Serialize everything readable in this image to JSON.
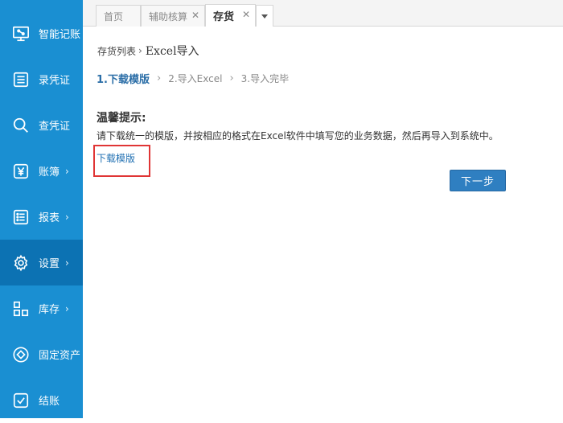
{
  "sidebar": {
    "items": [
      {
        "label": "智能记账",
        "icon": "monitor-icon",
        "has_arrow": false
      },
      {
        "label": "录凭证",
        "icon": "voucher-entry-icon",
        "has_arrow": false
      },
      {
        "label": "查凭证",
        "icon": "search-icon",
        "has_arrow": false
      },
      {
        "label": "账簿",
        "icon": "yen-icon",
        "has_arrow": true
      },
      {
        "label": "报表",
        "icon": "report-list-icon",
        "has_arrow": true
      },
      {
        "label": "设置",
        "icon": "gear-icon",
        "has_arrow": true,
        "active": true
      },
      {
        "label": "库存",
        "icon": "inventory-grid-icon",
        "has_arrow": true
      },
      {
        "label": "固定资产",
        "icon": "asset-diamond-icon",
        "has_arrow": false
      },
      {
        "label": "结账",
        "icon": "checkbox-icon",
        "has_arrow": false
      }
    ],
    "arrow_glyph": "›"
  },
  "tabs": [
    {
      "label": "首页",
      "closable": false
    },
    {
      "label": "辅助核算",
      "closable": true
    },
    {
      "label": "存货",
      "closable": true,
      "active": true
    }
  ],
  "tab_close_glyph": "✕",
  "breadcrumb": {
    "parent": "存货列表",
    "separator": "›",
    "current": "Excel导入"
  },
  "steps": {
    "items": [
      "1.下载模版",
      "2.导入Excel",
      "3.导入完毕"
    ],
    "separator": "›",
    "active_index": 0
  },
  "tip": {
    "title": "温馨提示:",
    "text": "请下载统一的模版，并按相应的格式在Excel软件中填写您的业务数据，然后再导入到系统中。"
  },
  "download_link": "下载模版",
  "next_button": "下一步",
  "colors": {
    "sidebar": "#1a8fd2",
    "sidebar_active": "#0c72b3",
    "accent": "#2f7fc1",
    "highlight_border": "#e03535"
  }
}
